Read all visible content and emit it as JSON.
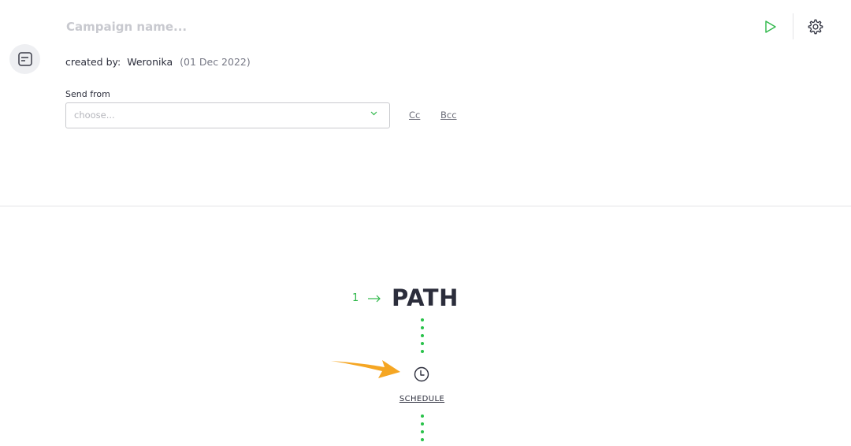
{
  "header": {
    "campaign_name_value": "",
    "campaign_name_placeholder": "Campaign name...",
    "run_icon": "play-icon",
    "settings_icon": "gear-icon",
    "document_icon": "document-icon"
  },
  "meta": {
    "created_by_label": "created by:",
    "author": "Weronika",
    "date": "(01 Dec 2022)"
  },
  "send_from": {
    "label": "Send from",
    "placeholder": "choose...",
    "cc_label": "Cc",
    "bcc_label": "Bcc"
  },
  "path": {
    "step_number": "1",
    "title": "PATH",
    "schedule_label": "SCHEDULE"
  },
  "colors": {
    "accent_green": "#2fb84a",
    "annotation_orange": "#f5a623"
  }
}
